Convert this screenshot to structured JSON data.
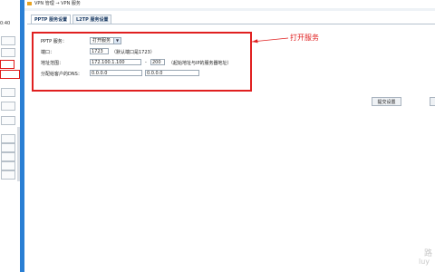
{
  "sidebar": {
    "top_text": "",
    "time_text": "0:40",
    "items": [
      "",
      "",
      "",
      "",
      "",
      "",
      "",
      ""
    ]
  },
  "breadcrumb": {
    "text": "VPN 管理 → VPN 服务"
  },
  "tabs": [
    {
      "label": "PPTP 服务设置",
      "active": true
    },
    {
      "label": "L2TP 服务设置",
      "active": false
    }
  ],
  "form": {
    "pptp_label": "PPTP 服务：",
    "pptp_value": "打开服务",
    "port_label": "端口：",
    "port_value": "1723",
    "port_hint": "（默认端口是1723）",
    "range_label": "地址范围：",
    "range_start": "172.100.1.100",
    "range_sep": "-",
    "range_end": "200",
    "range_hint": "（起始地址与IP的服务器地址）",
    "dns_label": "分配给客户的DNS：",
    "dns1": "0.0.0.0",
    "dns2": "0.0.0.0"
  },
  "callout": {
    "text": "打开服务",
    "color": "#e02020"
  },
  "buttons": {
    "submit": "提交设置",
    "second": ""
  },
  "watermark": {
    "line1": "路",
    "line2": "luy"
  },
  "colors": {
    "accent_blue": "#2a7fd4",
    "highlight_red": "#e02020"
  }
}
